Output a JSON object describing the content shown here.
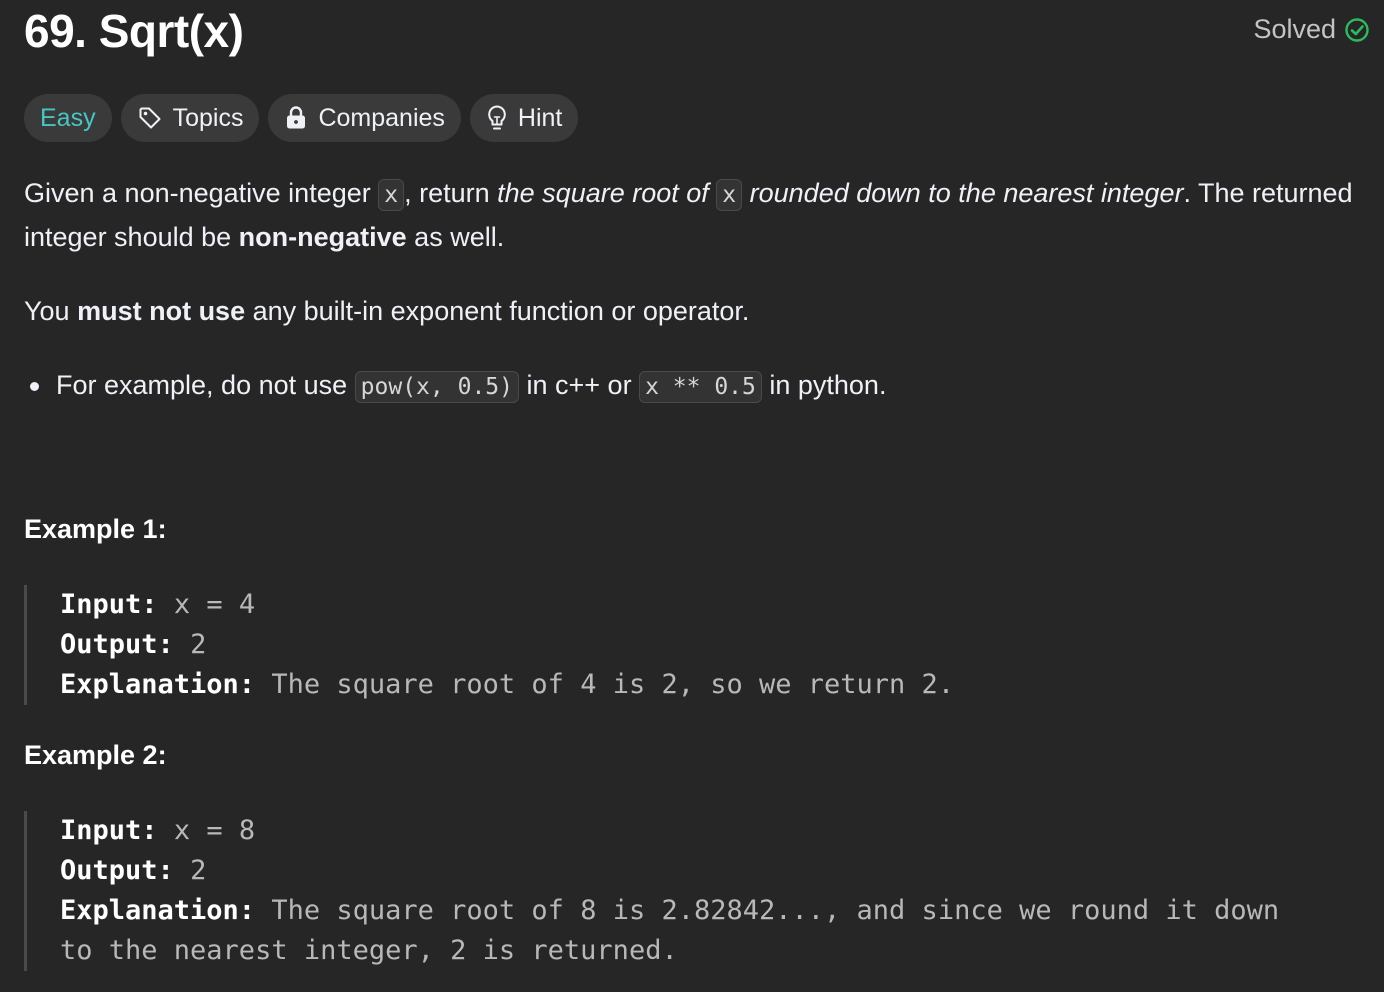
{
  "problem": {
    "title": "69. Sqrt(x)",
    "status": "Solved",
    "status_color": "#2cbb5d",
    "difficulty_color": "#46c6c2"
  },
  "tags": {
    "difficulty": "Easy",
    "topics": "Topics",
    "companies": "Companies",
    "hint": "Hint"
  },
  "description": {
    "p1": {
      "t1": "Given a non-negative integer ",
      "code1": "x",
      "t2": ", return ",
      "em1": "the square root of ",
      "code2": "x",
      "em2": " rounded down to the nearest integer",
      "t3": ". The returned integer should be ",
      "strong1": "non-negative",
      "t4": " as well."
    },
    "p2": {
      "t1": "You ",
      "strong1": "must not use",
      "t2": " any built-in exponent function or operator."
    },
    "bullet": {
      "t1": "For example, do not use ",
      "code1": "pow(x, 0.5)",
      "t2": " in c++ or ",
      "code2": "x ** 0.5",
      "t3": " in python."
    }
  },
  "examples": [
    {
      "title": "Example 1:",
      "input_label": "Input:",
      "input": "x = 4",
      "output_label": "Output:",
      "output": "2",
      "explanation_label": "Explanation:",
      "explanation": "The square root of 4 is 2, so we return 2."
    },
    {
      "title": "Example 2:",
      "input_label": "Input:",
      "input": "x = 8",
      "output_label": "Output:",
      "output": "2",
      "explanation_label": "Explanation:",
      "explanation": "The square root of 8 is 2.82842..., and since we round it down to the nearest integer, 2 is returned."
    }
  ],
  "icons": {
    "solved": "check-circle-icon",
    "topics": "tag-icon",
    "companies": "lock-icon",
    "hint": "lightbulb-icon"
  }
}
